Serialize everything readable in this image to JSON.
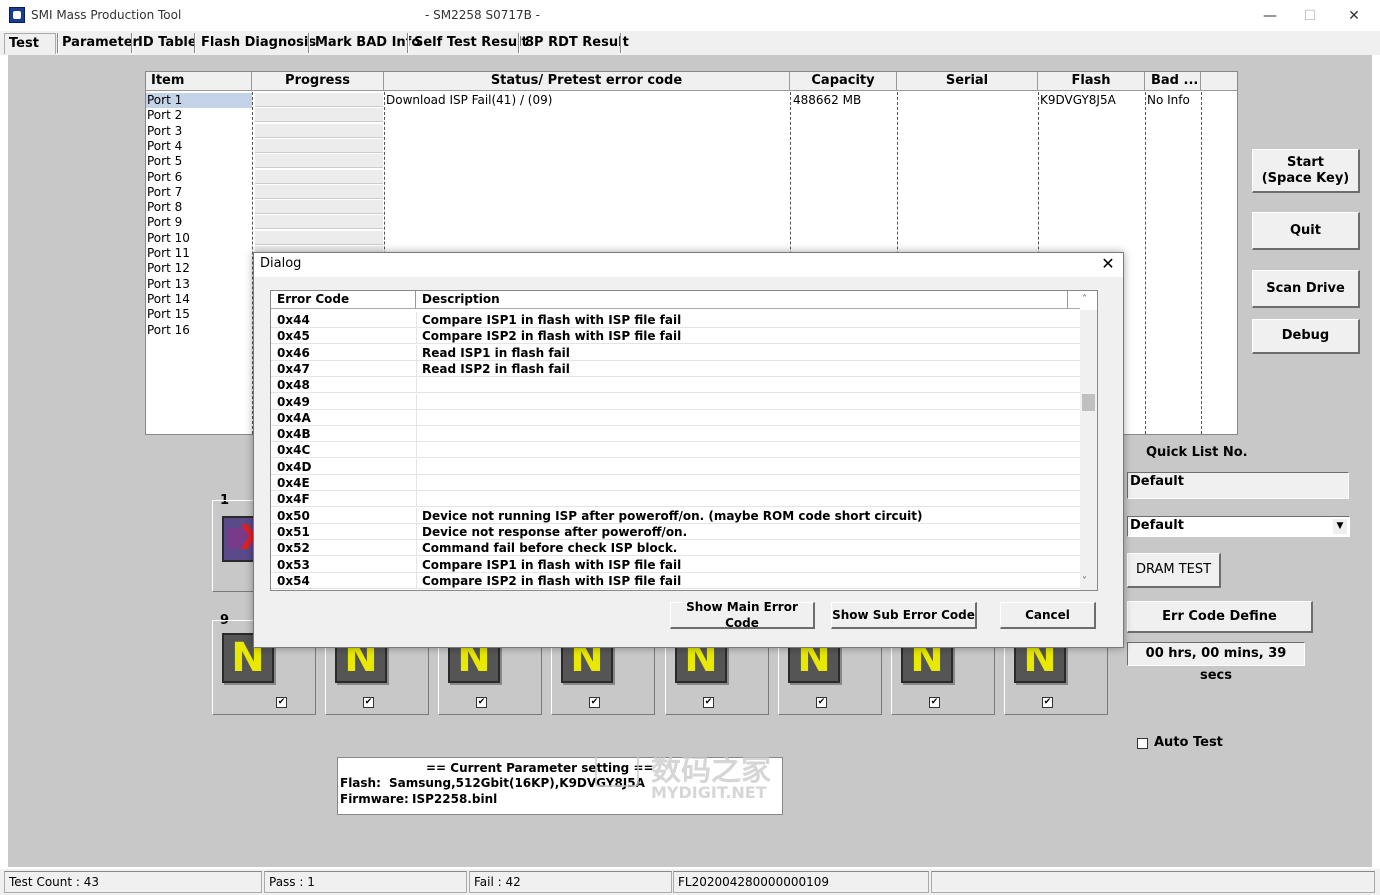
{
  "window": {
    "title": "SMI Mass Production Tool",
    "subtitle": "- SM2258 S0717B -",
    "minimize": "—",
    "maximize": "☐",
    "close": "✕"
  },
  "tabs": [
    {
      "label": "Test"
    },
    {
      "label": "Parameter"
    },
    {
      "label": "ID Table"
    },
    {
      "label": "Flash Diagnosis"
    },
    {
      "label": "Mark BAD Info"
    },
    {
      "label": "Self Test Result"
    },
    {
      "label": "8P RDT Result"
    }
  ],
  "port_table": {
    "headers": [
      "Item",
      "Progress",
      "Status/ Pretest error code",
      "Capacity",
      "Serial",
      "Flash",
      "Bad ..."
    ],
    "ports": [
      "Port 1",
      "Port 2",
      "Port 3",
      "Port 4",
      "Port 5",
      "Port 6",
      "Port 7",
      "Port 8",
      "Port 9",
      "Port 10",
      "Port 11",
      "Port 12",
      "Port 13",
      "Port 14",
      "Port 15",
      "Port 16"
    ],
    "row1": {
      "status": "Download ISP Fail(41) / (09)",
      "capacity": "488662 MB",
      "flash": "K9DVGY8J5A",
      "bad": "No Info"
    }
  },
  "right_panel": {
    "start_label": "Start\n(Space Key)",
    "quit_label": "Quit",
    "scan_label": "Scan Drive",
    "debug_label": "Debug",
    "quick_list_label": "Quick List No.",
    "quick_list_value": "Default",
    "dropdown_value": "Default",
    "dram_test_label": "DRAM TEST",
    "err_code_define_label": "Err Code Define",
    "timer": "00 hrs, 00 mins, 39 secs",
    "auto_test_label": "Auto Test"
  },
  "slots": {
    "group1_label": "1",
    "group2_label": "9",
    "icon_letter": "N"
  },
  "param_panel": {
    "heading": "== Current Parameter setting ==",
    "flash_label": "Flash:",
    "flash_value": "Samsung,512Gbit(16KP),K9DVGY8J5A",
    "firmware_label": "Firmware:",
    "firmware_value": "ISP2258.binl"
  },
  "status_bar": {
    "test_count": "Test Count : 43",
    "pass": "Pass : 1",
    "fail": "Fail : 42",
    "lot": "FL202004280000000109"
  },
  "dialog": {
    "title": "Dialog",
    "close": "✕",
    "col_code": "Error Code",
    "col_desc": "Description",
    "rows": [
      {
        "code": "0x44",
        "desc": "Compare ISP1 in flash with ISP file fail"
      },
      {
        "code": "0x45",
        "desc": "Compare ISP2 in flash with ISP file fail"
      },
      {
        "code": "0x46",
        "desc": "Read ISP1 in flash fail"
      },
      {
        "code": "0x47",
        "desc": "Read ISP2 in flash fail"
      },
      {
        "code": "0x48",
        "desc": ""
      },
      {
        "code": "0x49",
        "desc": ""
      },
      {
        "code": "0x4A",
        "desc": ""
      },
      {
        "code": "0x4B",
        "desc": ""
      },
      {
        "code": "0x4C",
        "desc": ""
      },
      {
        "code": "0x4D",
        "desc": ""
      },
      {
        "code": "0x4E",
        "desc": ""
      },
      {
        "code": "0x4F",
        "desc": ""
      },
      {
        "code": "0x50",
        "desc": "Device not running ISP after poweroff/on. (maybe ROM code short circuit)"
      },
      {
        "code": "0x51",
        "desc": "Device not response after poweroff/on."
      },
      {
        "code": "0x52",
        "desc": "Command fail before check  ISP block."
      },
      {
        "code": "0x53",
        "desc": "Compare ISP1 in flash with ISP file fail"
      },
      {
        "code": "0x54",
        "desc": "Compare ISP2 in flash with ISP file fail"
      }
    ],
    "btn_main": "Show Main Error Code",
    "btn_sub": "Show Sub Error Code",
    "btn_cancel": "Cancel"
  },
  "watermark": {
    "cn": "数码之家",
    "en": "MYDIGIT.NET"
  }
}
